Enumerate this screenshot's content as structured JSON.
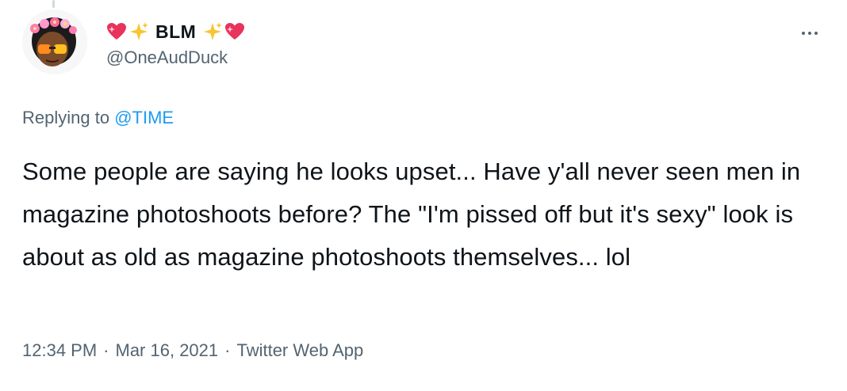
{
  "tweet": {
    "display_name": "BLM",
    "handle": "@OneAudDuck",
    "reply_prefix": "Replying to",
    "reply_to": "@TIME",
    "text": "Some people are saying he looks upset... Have y'all never seen men in magazine photoshoots before? The \"I'm pissed off but it's sexy\" look is about as old as magazine photoshoots themselves... lol",
    "time": "12:34 PM",
    "date": "Mar 16, 2021",
    "source": "Twitter Web App",
    "separator": "·"
  },
  "icons": {
    "name_decor_left": [
      "sparkling-heart-icon",
      "sparkles-icon"
    ],
    "name_decor_right": [
      "sparkles-icon",
      "sparkling-heart-icon"
    ],
    "more": "more-icon"
  },
  "colors": {
    "text_primary": "#0f1419",
    "text_secondary": "#536471",
    "link": "#1d9bf0",
    "heart": "#e8335a",
    "sparkle": "#f7c531"
  }
}
